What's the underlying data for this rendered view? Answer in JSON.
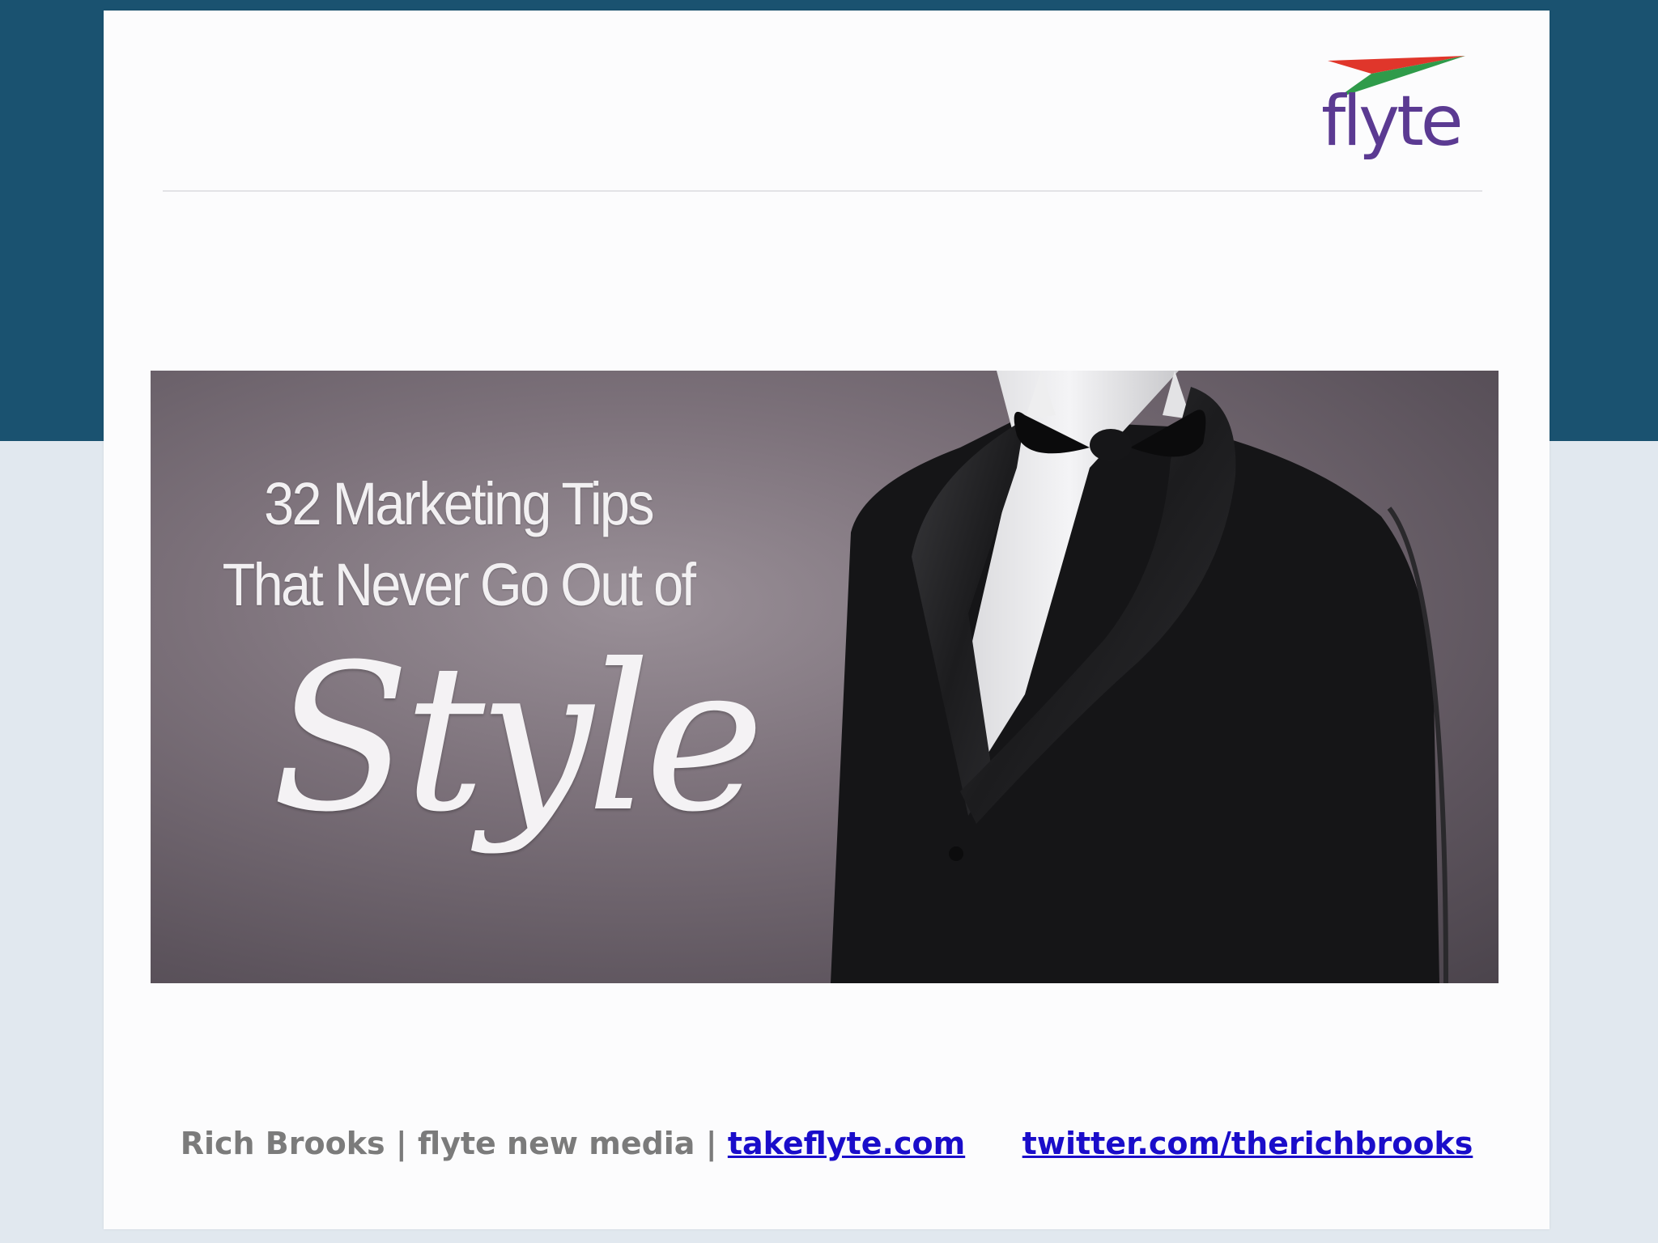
{
  "brand": {
    "logo_text": "flyte",
    "colors": {
      "purple": "#5b3a92",
      "red": "#e0362b",
      "green": "#2f9b4a",
      "header_blue": "#1a5270"
    }
  },
  "banner": {
    "line1": "32 Marketing Tips",
    "line2": "That Never Go Out of",
    "script_word": "Style"
  },
  "footer": {
    "author": "Rich Brooks",
    "separator": "|",
    "company": "flyte new media",
    "site_link": "takeflyte.com",
    "twitter_link": "twitter.com/therichbrooks"
  }
}
